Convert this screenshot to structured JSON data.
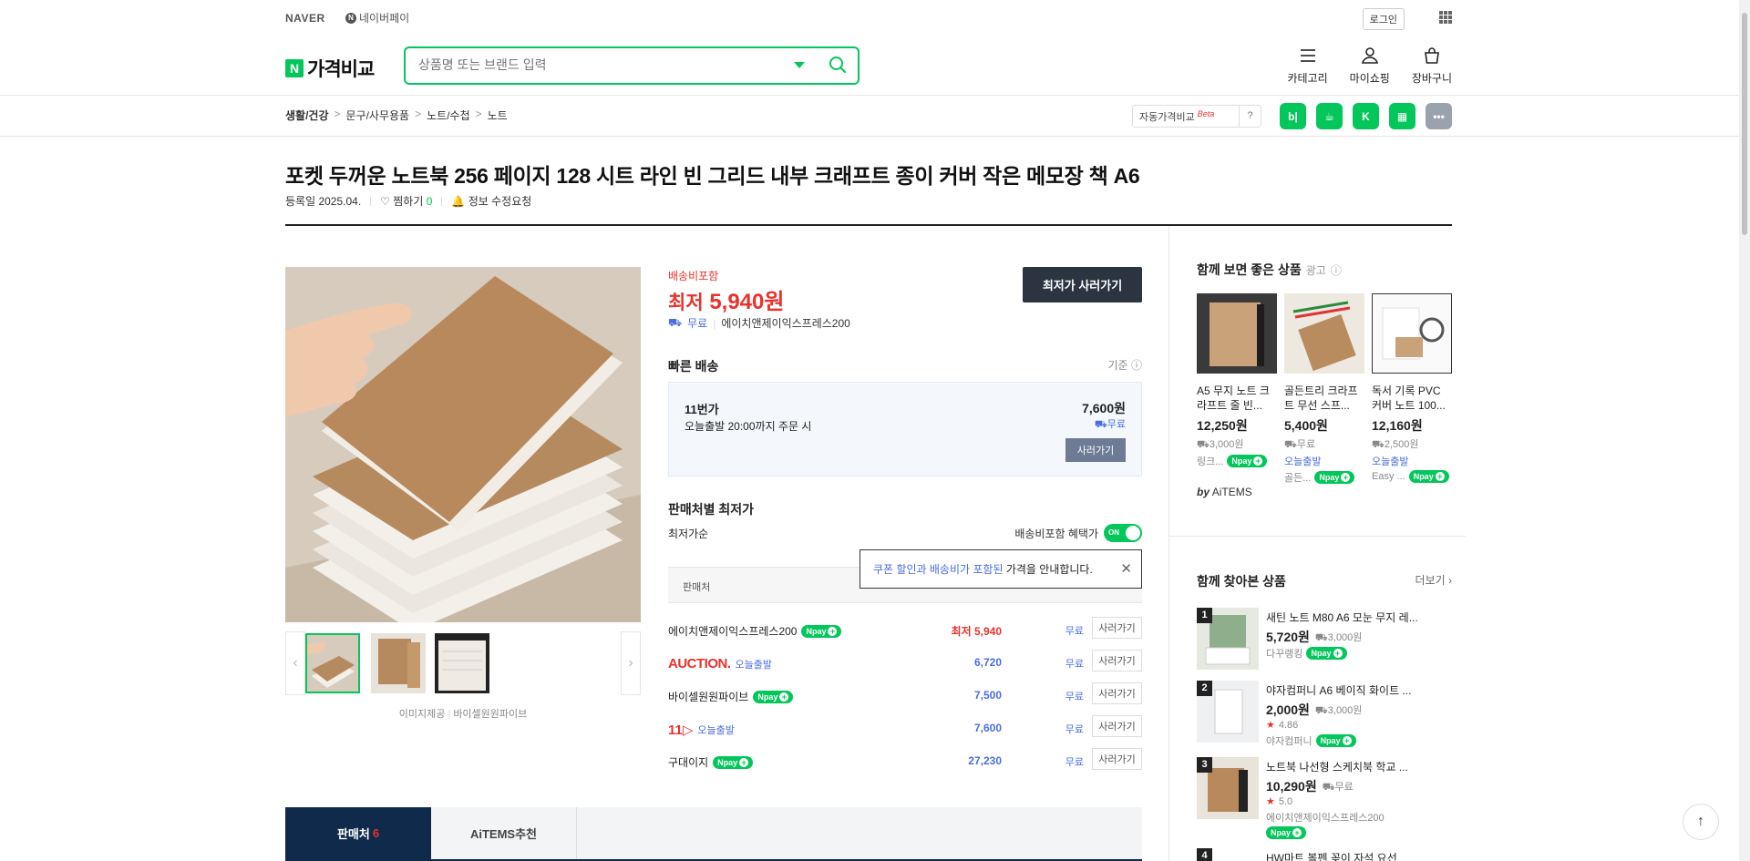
{
  "topbar": {
    "naver": "NAVER",
    "npay": "네이버페이",
    "login": "로그인"
  },
  "header": {
    "brand": "가격비교",
    "search_placeholder": "상품명 또는 브랜드 입력",
    "icons": [
      {
        "label": "카테고리",
        "icon": "menu-icon"
      },
      {
        "label": "마이쇼핑",
        "icon": "user-icon"
      },
      {
        "label": "장바구니",
        "icon": "cart-icon"
      }
    ]
  },
  "breadcrumb": [
    "생활/건강",
    "문구/사무용품",
    "노트/수첩",
    "노트"
  ],
  "auto_compare": {
    "label": "자동가격비교",
    "beta": "Beta",
    "help": "?"
  },
  "apps": [
    {
      "icon": "blog-icon",
      "text": "b|",
      "color": "#03c75a"
    },
    {
      "icon": "cafe-icon",
      "text": "☕",
      "color": "#03c75a"
    },
    {
      "icon": "kin-icon",
      "text": "K",
      "color": "#03c75a"
    },
    {
      "icon": "news-icon",
      "text": "▦",
      "color": "#03c75a"
    },
    {
      "icon": "more-icon",
      "text": "•••",
      "color": "#9aa3ad"
    }
  ],
  "product": {
    "title": "포켓 두꺼운 노트북 256 페이지 128 시트 라인 빈 그리드 내부 크래프트 종이 커버 작은 메모장 책 A6",
    "reg_date": "등록일 2025.04.",
    "wish_label": "찜하기",
    "wish_count": "0",
    "edit_request": "정보 수정요청",
    "image_credit": "이미지제공",
    "image_source": "바이셀원원파이브"
  },
  "price": {
    "shipping_included": "배송비포함",
    "lowest_prefix": "최저",
    "lowest_price": "5,940원",
    "free": "무료",
    "seller": "에이치앤제이익스프레스200",
    "buy_button": "최저가 사러가기"
  },
  "fast_delivery": {
    "title": "빠른 배송",
    "basis": "기준",
    "seller": "11번가",
    "desc": "오늘출발 20:00까지 주문 시",
    "price": "7,600원",
    "free": "무료",
    "button": "사러가기"
  },
  "seller_list": {
    "title": "판매처별 최저가",
    "sort": "최저가순",
    "toggle_label": "배송비포함 혜택가",
    "toggle_state": "ON",
    "tooltip_hl": "쿠폰 할인과 배송비가 포함된",
    "tooltip_rest": " 가격을 안내합니다.",
    "header": "판매처",
    "rows": [
      {
        "name": "에이치앤제이익스프레스200",
        "badge": "npay",
        "price": "최저 5,940",
        "free": "무료",
        "button": "사러가기"
      },
      {
        "name": "AUCTION.",
        "badge": "today",
        "today": "오늘출발",
        "price": "6,720",
        "free": "무료",
        "button": "사러가기"
      },
      {
        "name": "바이셀원원파이브",
        "badge": "npay",
        "price": "7,500",
        "free": "무료",
        "button": "사러가기"
      },
      {
        "name": "11",
        "badge": "today",
        "today": "오늘출발",
        "price": "7,600",
        "free": "무료",
        "button": "사러가기"
      },
      {
        "name": "구대이지",
        "badge": "npay",
        "price": "27,230",
        "free": "무료",
        "button": "사러가기"
      }
    ]
  },
  "tabs": [
    {
      "label": "판매처",
      "count": "6"
    },
    {
      "label": "AiTEMS추천"
    }
  ],
  "recommend": {
    "title": "함께 보면 좋은 상품",
    "ad": "광고",
    "items": [
      {
        "name": "A5 무지 노트 크라프트 줄 빈...",
        "price": "12,250원",
        "ship": "3,000원",
        "seller": "링크..."
      },
      {
        "name": "골든트리 크라프트 무선 스프...",
        "price": "5,400원",
        "ship": "무료",
        "today": "오늘출발",
        "seller": "골든..."
      },
      {
        "name": "독서 기록 PVC 커버 노트 100...",
        "price": "12,160원",
        "ship": "2,500원",
        "today": "오늘출발",
        "seller": "Easy ..."
      }
    ],
    "by": "by",
    "aitems": "AiTEMS"
  },
  "viewed": {
    "title": "함께 찾아본 상품",
    "more": "더보기",
    "items": [
      {
        "rank": "1",
        "name": "새틴 노트 M80 A6 모눈 무지 레...",
        "price": "5,720원",
        "ship": "3,000원",
        "seller": "다꾸랭킹"
      },
      {
        "rank": "2",
        "name": "야자컴퍼니 A6 베이직 화이트 ...",
        "price": "2,000원",
        "ship": "3,000원",
        "rating": "4.86",
        "seller": "야자컴퍼니"
      },
      {
        "rank": "3",
        "name": "노트북 나선형 스케치북 학교 ...",
        "price": "10,290원",
        "ship": "무료",
        "rating": "5.0",
        "seller": "에이치앤제이익스프레스200"
      },
      {
        "rank": "4",
        "name": "HW마트 볼펜 꽂이 자석 요선"
      }
    ]
  },
  "npay_text": "pay"
}
